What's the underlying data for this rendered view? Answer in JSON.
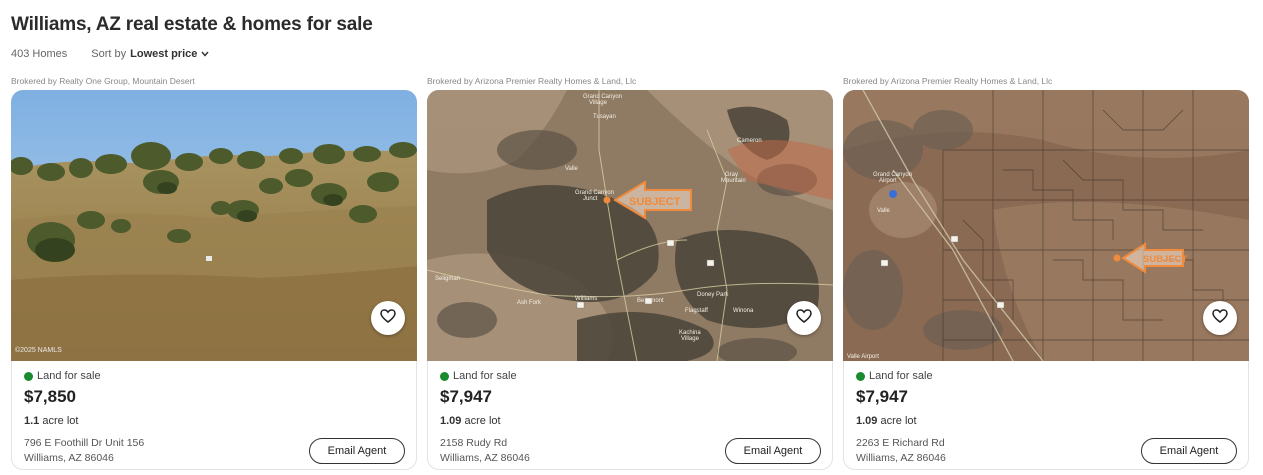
{
  "header": {
    "title": "Williams, AZ real estate & homes for sale",
    "count": "403 Homes",
    "sort_prefix": "Sort by",
    "sort_value": "Lowest price"
  },
  "listings": [
    {
      "broker": "Brokered by Realty One Group, Mountain Desert",
      "status": "Land for sale",
      "price": "$7,850",
      "lot_size": "1.1",
      "lot_unit": "acre lot",
      "address_line1": "796 E Foothill Dr Unit 156",
      "address_line2": "Williams, AZ 86046",
      "email_label": "Email Agent",
      "photo_overlay": "©2025 NAMLS"
    },
    {
      "broker": "Brokered by Arizona Premier Realty Homes & Land, Llc",
      "status": "Land for sale",
      "price": "$7,947",
      "lot_size": "1.09",
      "lot_unit": "acre lot",
      "address_line1": "2158 Rudy Rd",
      "address_line2": "Williams, AZ 86046",
      "email_label": "Email Agent",
      "map_label": "SUBJECT"
    },
    {
      "broker": "Brokered by Arizona Premier Realty Homes & Land, Llc",
      "status": "Land for sale",
      "price": "$7,947",
      "lot_size": "1.09",
      "lot_unit": "acre lot",
      "address_line1": "2263 E Richard Rd",
      "address_line2": "Williams, AZ 86046",
      "email_label": "Email Agent",
      "map_label": "SUBJECT"
    }
  ],
  "colors": {
    "status_green": "#1a8a2e",
    "subject_orange": "#f08a3c",
    "sky_blue": "#8ab6e0"
  },
  "icons": {
    "favorite": "heart-icon",
    "sort": "chevron-down-icon",
    "status": "status-dot-icon"
  }
}
